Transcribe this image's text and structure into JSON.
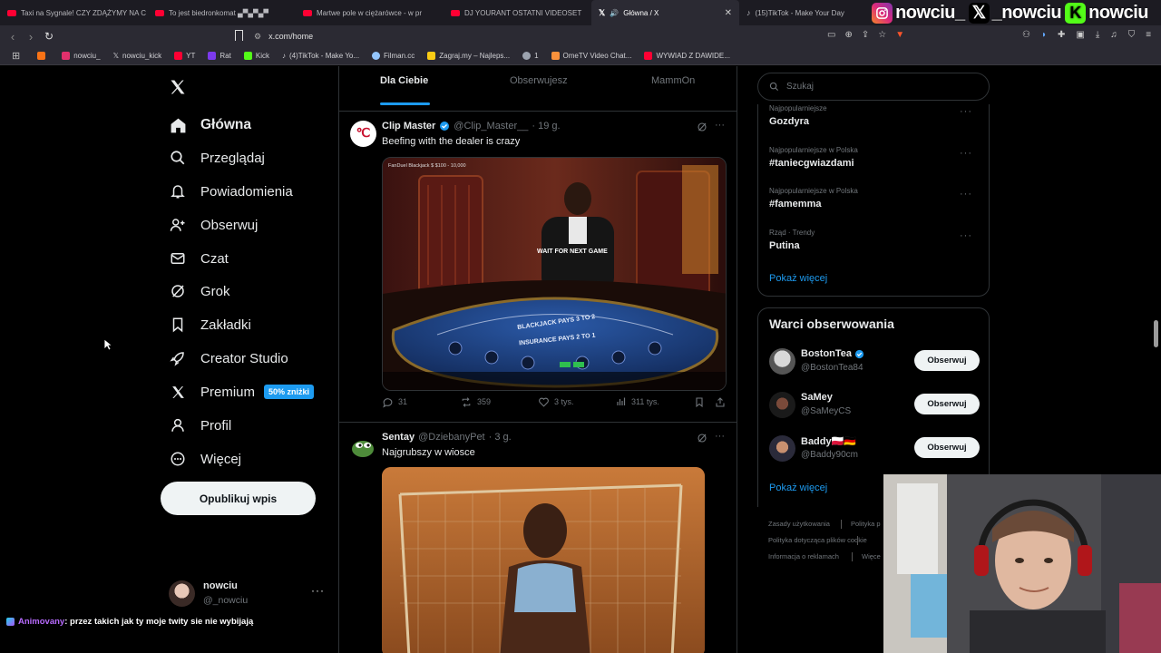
{
  "browser": {
    "tabs": [
      {
        "title": "Taxi na Sygnale! CZY ZDĄŻYMY NA C",
        "fav_color": "#ff0033"
      },
      {
        "title": "To jest biedronkomat ▄▀▄▀▄▀",
        "fav_color": "#ff0033"
      },
      {
        "title": "Martwe pole w ciężarówce - w pr",
        "fav_color": "#ff0033"
      },
      {
        "title": "DJ YOURANT OSTATNI VIDEOSET",
        "fav_color": "#ff0033"
      },
      {
        "title": "Główna / X",
        "fav_color": "#ffffff"
      },
      {
        "title": "(15)TikTok - Make Your Day",
        "fav_color": "#ffffff"
      }
    ],
    "url": "x.com/home",
    "bookmarks": [
      {
        "label": "",
        "color": "#f97316"
      },
      {
        "label": "nowciu_",
        "color": "#e1306c"
      },
      {
        "label": "nowciu_kick",
        "color": "#ffffff"
      },
      {
        "label": "YT",
        "color": "#ff0033"
      },
      {
        "label": "Rat",
        "color": "#7c3aed"
      },
      {
        "label": "Kick",
        "color": "#53fc18"
      },
      {
        "label": "(4)TikTok - Make Yo...",
        "color": "#ffffff"
      },
      {
        "label": "Filman.cc",
        "color": "#93c5fd"
      },
      {
        "label": "Zagraj.my – Najleps...",
        "color": "#facc15"
      },
      {
        "label": "1",
        "color": "#9ca3af"
      },
      {
        "label": "OmeTV Video Chat...",
        "color": "#fb923c"
      },
      {
        "label": "WYWIAD Z DAWIDE...",
        "color": "#ff0033"
      }
    ],
    "socials": [
      {
        "name": "nowciu_",
        "icon": "instagram-icon"
      },
      {
        "name": "_nowciu",
        "icon": "x-icon"
      },
      {
        "name": "nowciu",
        "icon": "kick-icon"
      }
    ]
  },
  "nav": {
    "home": "Główna",
    "explore": "Przeglądaj",
    "notifications": "Powiadomienia",
    "follow": "Obserwuj",
    "chat": "Czat",
    "grok": "Grok",
    "bookmarks": "Zakładki",
    "creator_studio": "Creator Studio",
    "premium": "Premium",
    "premium_badge": "50% zniżki",
    "profile": "Profil",
    "more": "Więcej",
    "post_button": "Opublikuj wpis",
    "user_name": "nowciu",
    "user_handle": "@_nowciu"
  },
  "timeline": {
    "tabs": [
      "Dla Ciebie",
      "Obserwujesz",
      "MammOn"
    ],
    "tweets": [
      {
        "name": "Clip Master",
        "handle": "@Clip_Master__",
        "time": "· 19 g.",
        "text": "Beefing with the dealer is crazy",
        "media_caption": "WAIT FOR NEXT GAME",
        "media_header": "FanDuel Blackjack  $ $100 - 10,000",
        "table_text": "BLACKJACK PAYS 3 TO 2",
        "insurance_text": "INSURANCE PAYS 2 TO 1",
        "replies": "31",
        "reposts": "359",
        "likes": "3 tys.",
        "views": "311 tys."
      },
      {
        "name": "Sentay",
        "handle": "@DziebanyPet",
        "time": "· 3 g.",
        "text": "Najgrubszy w wiosce"
      }
    ]
  },
  "sidebar": {
    "search_placeholder": "Szukaj",
    "trends": [
      {
        "context": "Najpopularniejsze",
        "title": "Gozdyra"
      },
      {
        "context": "Najpopularniejsze w Polska",
        "title": "#taniecgwiazdami"
      },
      {
        "context": "Najpopularniejsze w Polska",
        "title": "#famemma"
      },
      {
        "context": "Rząd · Trendy",
        "title": "Putina"
      }
    ],
    "show_more": "Pokaż więcej",
    "who_to_follow_title": "Warci obserwowania",
    "who_to_follow": [
      {
        "name": "BostonTea",
        "handle": "@BostonTea84",
        "verified": true,
        "button": "Obserwuj"
      },
      {
        "name": "SaMey",
        "handle": "@SaMeyCS",
        "verified": false,
        "button": "Obserwuj"
      },
      {
        "name": "Baddy🇵🇱🇩🇪",
        "handle": "@Baddy90cm",
        "verified": false,
        "button": "Obserwuj"
      }
    ],
    "show_more_2": "Pokaż więcej",
    "footer": [
      "Zasady użytkowania",
      "Polityka p",
      "Polityka dotycząca plików cookie",
      "Informacja o reklamach",
      "Więce"
    ]
  },
  "chat_overlay": {
    "user": "Animovany",
    "message": ": przez takich jak ty moje twity sie nie wybijają"
  },
  "colors": {
    "accent": "#1d9bf0",
    "background": "#000000",
    "border": "#2f3336",
    "muted": "#71767b"
  }
}
